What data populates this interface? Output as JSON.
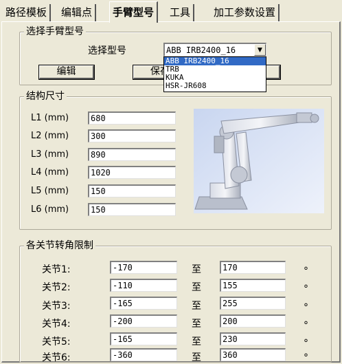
{
  "tabs": [
    {
      "label": "路径模板",
      "active": false
    },
    {
      "label": "编辑点",
      "active": false
    },
    {
      "label": "手臂型号",
      "active": true
    },
    {
      "label": "工具",
      "active": false
    },
    {
      "label": "加工参数设置",
      "active": false
    }
  ],
  "select_group": {
    "legend": "选择手臂型号",
    "select_label": "选择型号",
    "selected": "ABB IRB2400_16",
    "options": [
      "ABB IRB2400_16",
      "TRB",
      "KUKA",
      "HSR-JR608"
    ],
    "edit_button": "编辑",
    "save_button": "保存"
  },
  "dims": {
    "legend": "结构尺寸",
    "rows": [
      {
        "label": "L1 (mm)",
        "value": "680"
      },
      {
        "label": "L2 (mm)",
        "value": "300"
      },
      {
        "label": "L3 (mm)",
        "value": "890"
      },
      {
        "label": "L4 (mm)",
        "value": "1020"
      },
      {
        "label": "L5 (mm)",
        "value": "150"
      },
      {
        "label": "L6 (mm)",
        "value": "150"
      }
    ]
  },
  "limits": {
    "legend": "各关节转角限制",
    "to_label": "至",
    "unit": "°",
    "rows": [
      {
        "label": "关节1:",
        "min": "-170",
        "max": "170"
      },
      {
        "label": "关节2:",
        "min": "-110",
        "max": "155"
      },
      {
        "label": "关节3:",
        "min": "-165",
        "max": "255"
      },
      {
        "label": "关节4:",
        "min": "-200",
        "max": "200"
      },
      {
        "label": "关节5:",
        "min": "-165",
        "max": "230"
      },
      {
        "label": "关节6:",
        "min": "-360",
        "max": "360"
      }
    ]
  }
}
